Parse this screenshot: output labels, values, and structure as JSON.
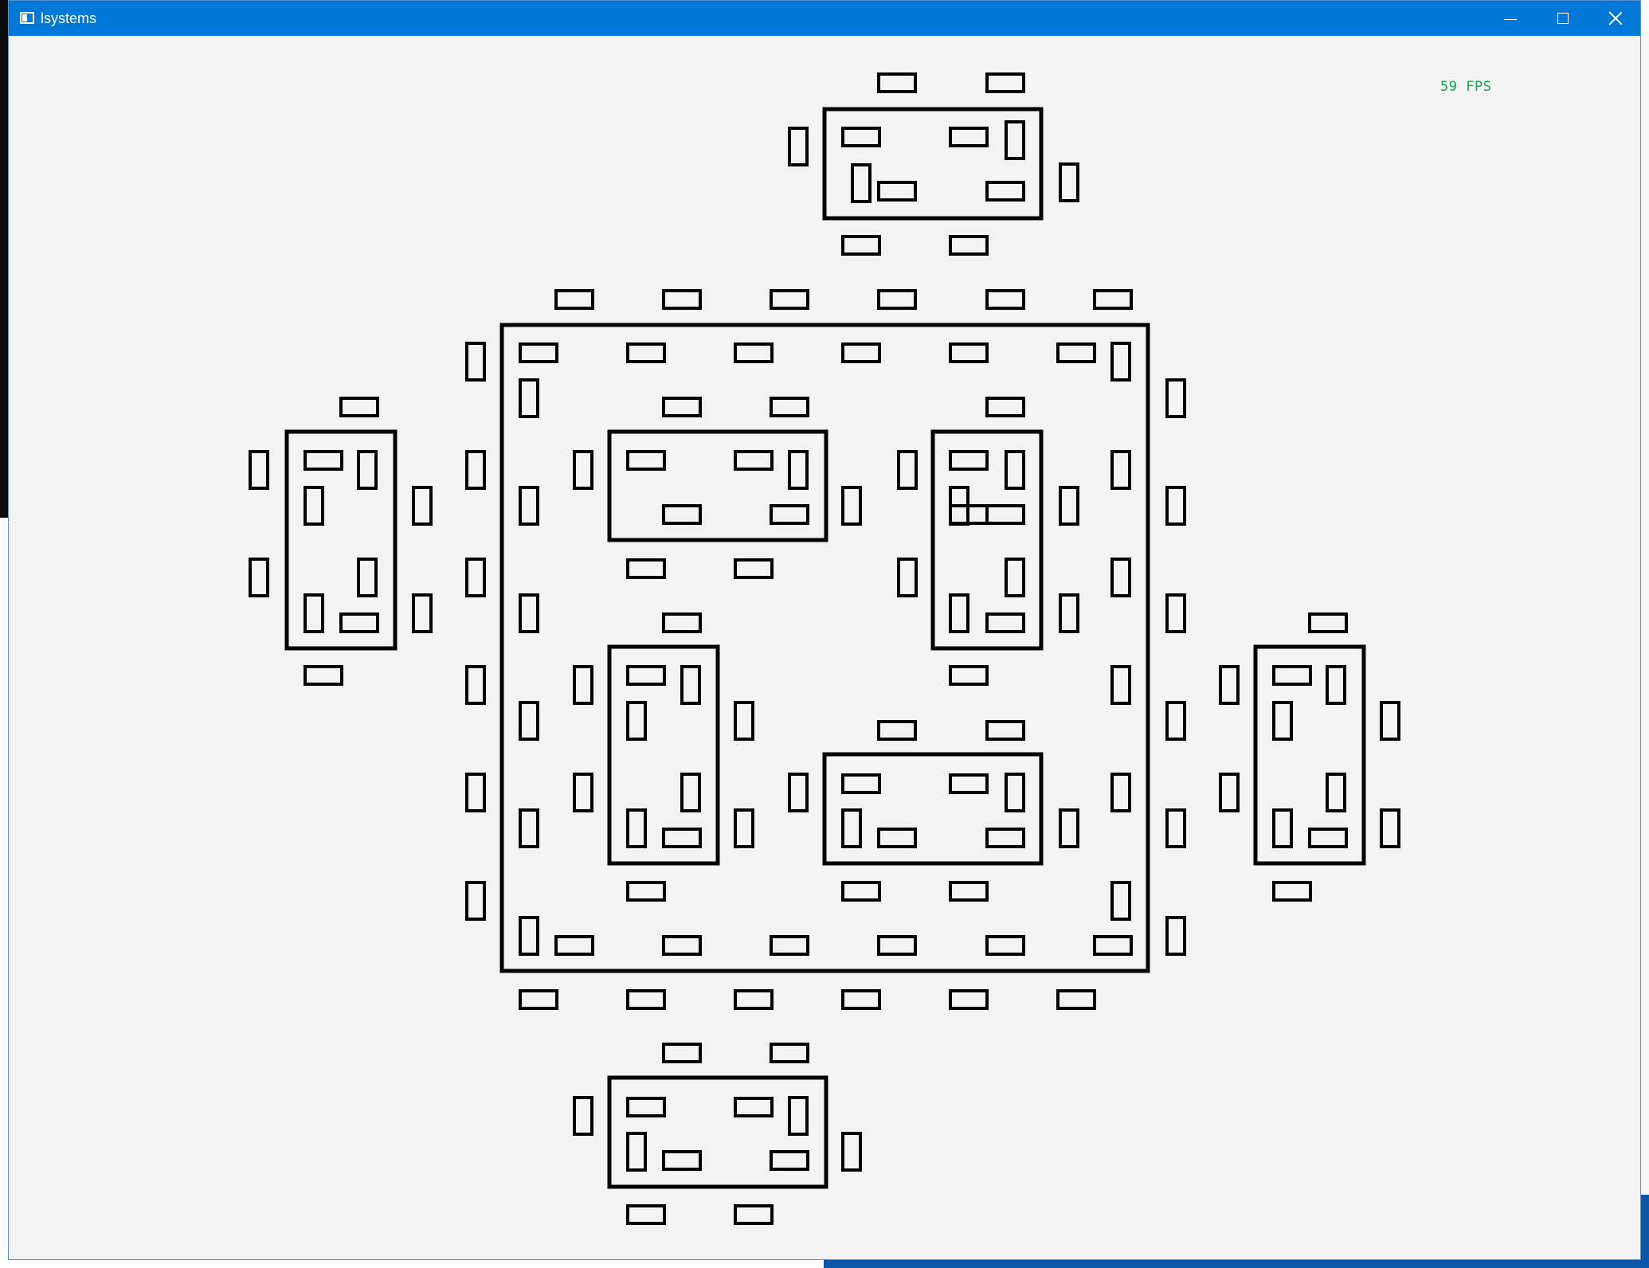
{
  "window": {
    "title": "lsystems",
    "icon": "app-window-icon",
    "controls": [
      "minimize-icon",
      "maximize-icon",
      "close-icon"
    ]
  },
  "overlay": {
    "fps_label": "59 FPS",
    "fps_color": "#16a34a"
  },
  "render": {
    "stroke_color": "#000000",
    "background_color": "#f3f3f3",
    "titlebar_color": "#0078d7"
  }
}
